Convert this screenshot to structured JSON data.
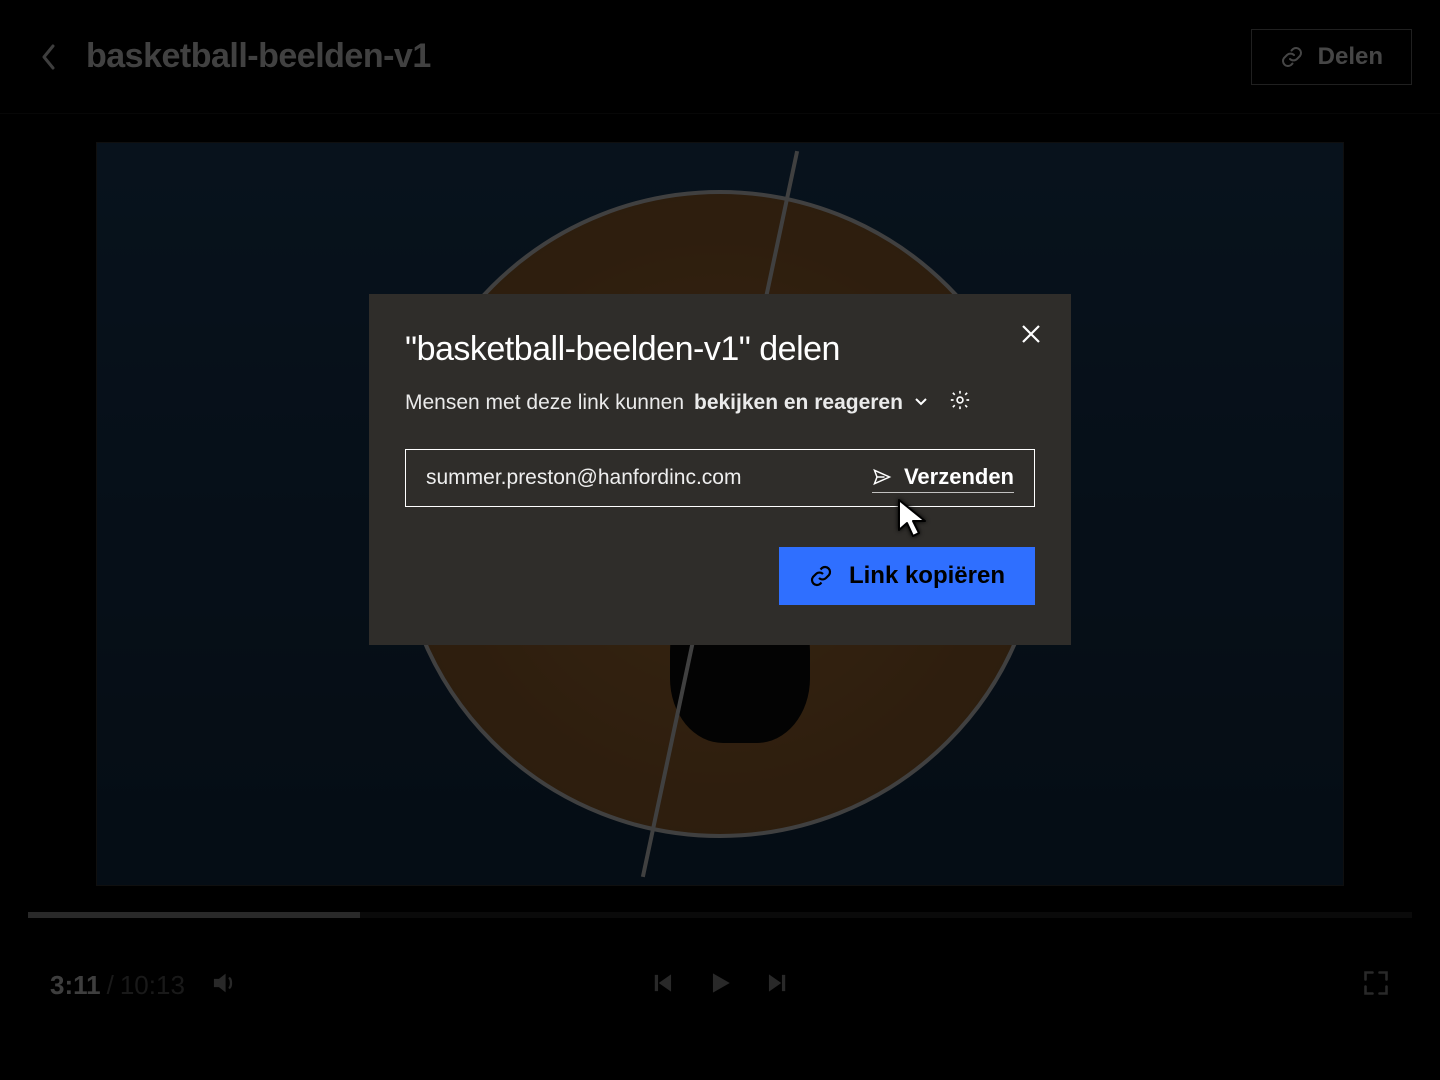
{
  "header": {
    "file_title": "basketball-beelden-v1",
    "share_label": "Delen"
  },
  "player": {
    "current_time": "3:11",
    "total_time": "10:13",
    "progress_percent": 24
  },
  "modal": {
    "title": "\"basketball-beelden-v1\" delen",
    "permission_prefix": "Mensen met deze link kunnen",
    "permission_mode": "bekijken en reageren",
    "email_value": "summer.preston@hanfordinc.com",
    "send_label": "Verzenden",
    "copy_label": "Link kopiëren"
  }
}
